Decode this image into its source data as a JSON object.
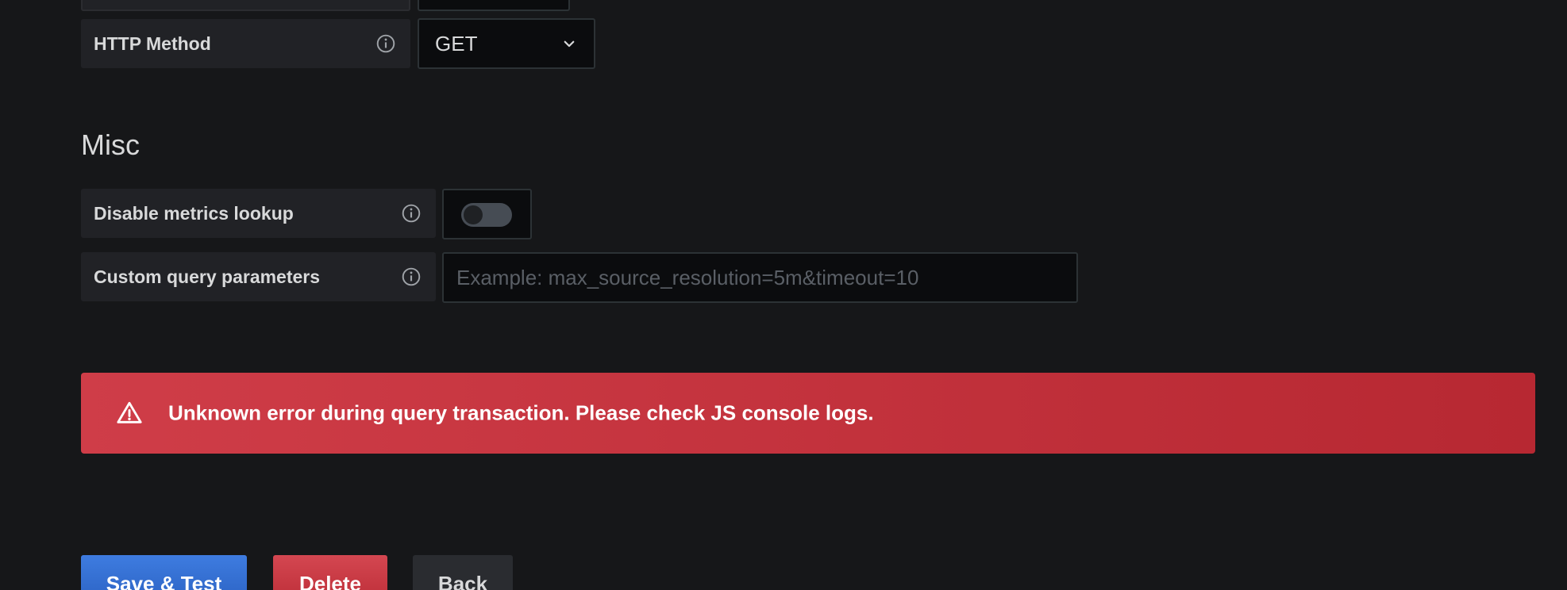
{
  "http": {
    "label": "HTTP Method",
    "value": "GET"
  },
  "misc": {
    "title": "Misc",
    "disable_metrics": {
      "label": "Disable metrics lookup",
      "enabled": false
    },
    "custom_params": {
      "label": "Custom query parameters",
      "value": "",
      "placeholder": "Example: max_source_resolution=5m&timeout=10"
    }
  },
  "alert": {
    "message": "Unknown error during query transaction. Please check JS console logs.",
    "color": "#c4313b"
  },
  "actions": {
    "save_label": "Save & Test",
    "delete_label": "Delete",
    "back_label": "Back"
  },
  "colors": {
    "background": "#161719",
    "primary": "#3274d9",
    "danger": "#d44a3a"
  }
}
